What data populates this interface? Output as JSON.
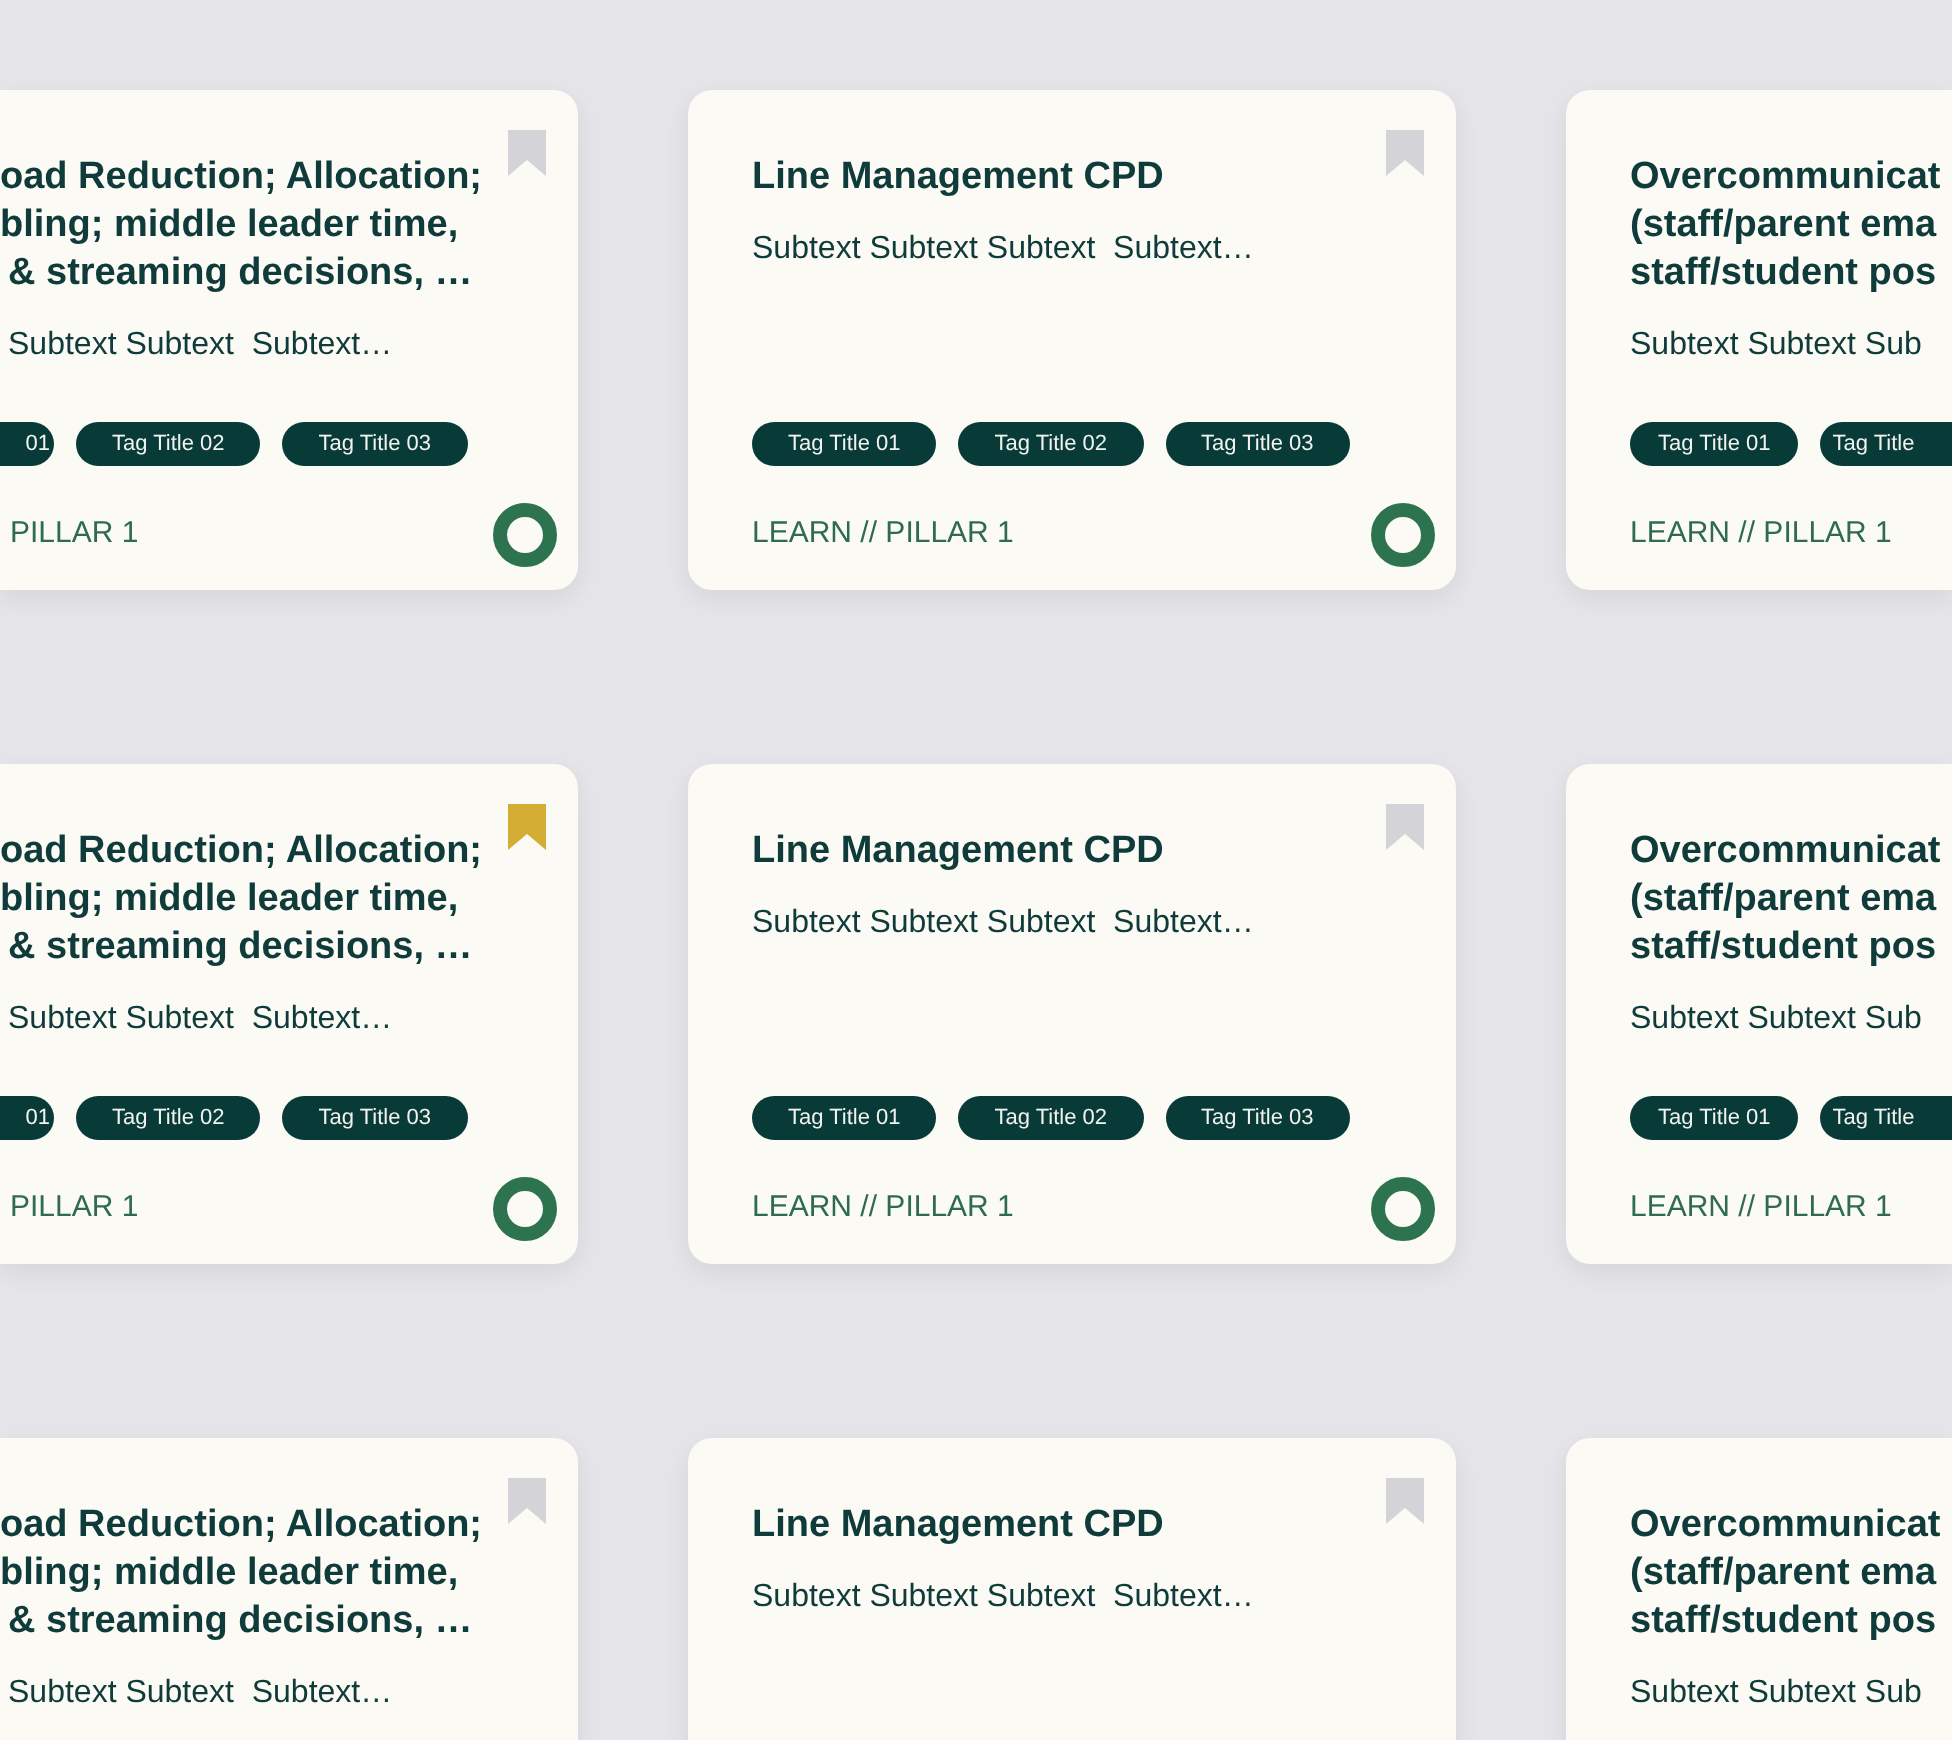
{
  "rows": [
    {
      "cards": [
        {
          "title_lines": [
            "oad Reduction; Allocation;",
            "bling; middle leader time,",
            "& streaming decisions, …"
          ],
          "subtext": "Subtext Subtext  Subtext…",
          "tags": [
            "01",
            "Tag Title 02",
            "Tag Title 03"
          ],
          "footer": "PILLAR 1",
          "bookmarked": false,
          "progress_ring": true
        },
        {
          "title_lines": [
            "Line Management CPD"
          ],
          "subtext": "Subtext Subtext Subtext  Subtext…",
          "tags": [
            "Tag Title 01",
            "Tag Title 02",
            "Tag Title 03"
          ],
          "footer": "LEARN // PILLAR 1",
          "bookmarked": false,
          "progress_ring": true
        },
        {
          "title_lines": [
            "Overcommunicat",
            "(staff/parent ema",
            "staff/student pos"
          ],
          "subtext": "Subtext Subtext Sub",
          "tags": [
            "Tag Title 01",
            "Tag Title"
          ],
          "footer": "LEARN // PILLAR 1"
        }
      ]
    },
    {
      "cards": [
        {
          "title_lines": [
            "oad Reduction; Allocation;",
            "bling; middle leader time,",
            "& streaming decisions, …"
          ],
          "subtext": "Subtext Subtext  Subtext…",
          "tags": [
            "01",
            "Tag Title 02",
            "Tag Title 03"
          ],
          "footer": "PILLAR 1",
          "bookmarked": true,
          "progress_ring": true
        },
        {
          "title_lines": [
            "Line Management CPD"
          ],
          "subtext": "Subtext Subtext Subtext  Subtext…",
          "tags": [
            "Tag Title 01",
            "Tag Title 02",
            "Tag Title 03"
          ],
          "footer": "LEARN // PILLAR 1",
          "bookmarked": false,
          "progress_ring": true
        },
        {
          "title_lines": [
            "Overcommunicat",
            "(staff/parent ema",
            "staff/student pos"
          ],
          "subtext": "Subtext Subtext Sub",
          "tags": [
            "Tag Title 01",
            "Tag Title"
          ],
          "footer": "LEARN // PILLAR 1"
        }
      ]
    },
    {
      "cards": [
        {
          "title_lines": [
            "oad Reduction; Allocation;",
            "bling; middle leader time,",
            "& streaming decisions, …"
          ],
          "subtext": "Subtext Subtext  Subtext…",
          "bookmarked": false
        },
        {
          "title_lines": [
            "Line Management CPD"
          ],
          "subtext": "Subtext Subtext Subtext  Subtext…",
          "bookmarked": false
        },
        {
          "title_lines": [
            "Overcommunicat",
            "(staff/parent ema",
            "staff/student pos"
          ],
          "subtext": "Subtext Subtext Sub"
        }
      ]
    }
  ]
}
